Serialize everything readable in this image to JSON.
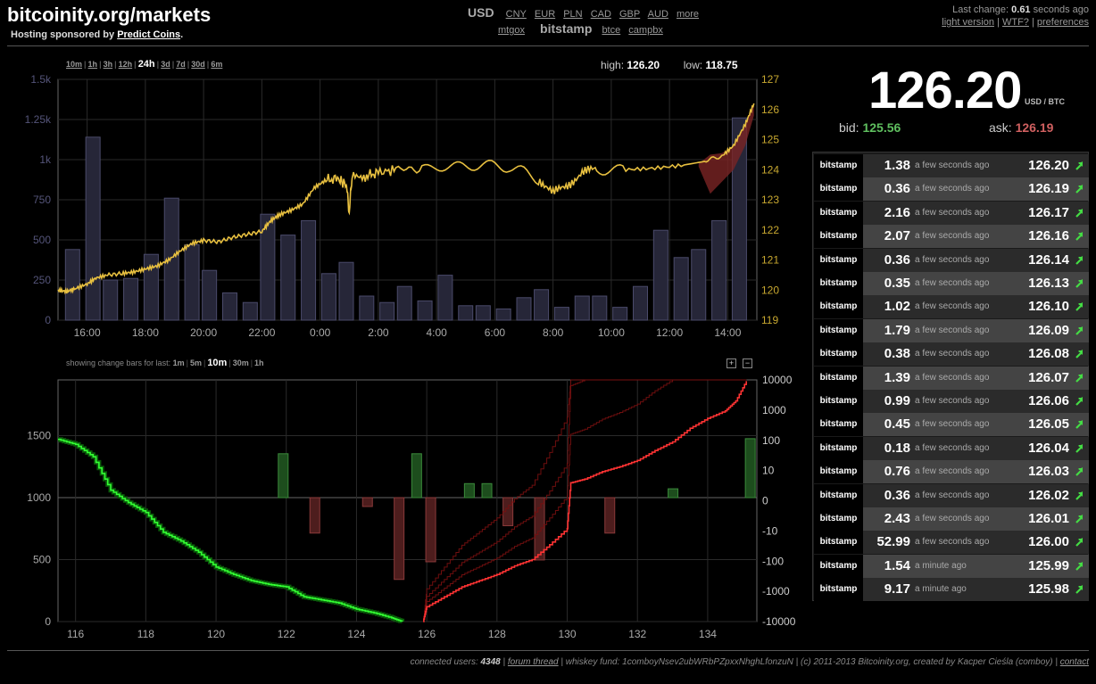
{
  "header": {
    "site_title": "bitcoinity.org/markets",
    "sponsor_prefix": "Hosting sponsored by ",
    "sponsor_link": "Predict Coins",
    "sponsor_suffix": ".",
    "active_currency": "USD",
    "currencies": [
      "CNY",
      "EUR",
      "PLN",
      "CAD",
      "GBP",
      "AUD",
      "more"
    ],
    "exchanges_before": [
      "mtgox"
    ],
    "active_exchange": "bitstamp",
    "exchanges_after": [
      "btce",
      "campbx"
    ],
    "last_change_prefix": "Last change: ",
    "last_change_value": "0.61",
    "last_change_suffix": " seconds ago",
    "links": [
      "light version",
      "WTF?",
      "preferences"
    ]
  },
  "periods": [
    "10m",
    "1h",
    "3h",
    "12h",
    "24h",
    "3d",
    "7d",
    "30d",
    "6m"
  ],
  "selected_period": "24h",
  "high_label": "high:",
  "high_value": "126.20",
  "low_label": "low:",
  "low_value": "118.75",
  "change_bars": {
    "label": "showing change bars for last:",
    "options": [
      "1m",
      "5m",
      "10m",
      "30m",
      "1h"
    ],
    "selected": "10m"
  },
  "ticker": {
    "price": "126.20",
    "unit": "USD / BTC",
    "bid_label": "bid:",
    "bid": "125.56",
    "ask_label": "ask:",
    "ask": "126.19"
  },
  "trades": [
    {
      "exchange": "bitstamp",
      "amount": "1.38",
      "time": "a few seconds ago",
      "price": "126.20"
    },
    {
      "exchange": "bitstamp",
      "amount": "0.36",
      "time": "a few seconds ago",
      "price": "126.19"
    },
    {
      "exchange": "bitstamp",
      "amount": "2.16",
      "time": "a few seconds ago",
      "price": "126.17"
    },
    {
      "exchange": "bitstamp",
      "amount": "2.07",
      "time": "a few seconds ago",
      "price": "126.16"
    },
    {
      "exchange": "bitstamp",
      "amount": "0.36",
      "time": "a few seconds ago",
      "price": "126.14"
    },
    {
      "exchange": "bitstamp",
      "amount": "0.35",
      "time": "a few seconds ago",
      "price": "126.13"
    },
    {
      "exchange": "bitstamp",
      "amount": "1.02",
      "time": "a few seconds ago",
      "price": "126.10"
    },
    {
      "exchange": "bitstamp",
      "amount": "1.79",
      "time": "a few seconds ago",
      "price": "126.09"
    },
    {
      "exchange": "bitstamp",
      "amount": "0.38",
      "time": "a few seconds ago",
      "price": "126.08"
    },
    {
      "exchange": "bitstamp",
      "amount": "1.39",
      "time": "a few seconds ago",
      "price": "126.07"
    },
    {
      "exchange": "bitstamp",
      "amount": "0.99",
      "time": "a few seconds ago",
      "price": "126.06"
    },
    {
      "exchange": "bitstamp",
      "amount": "0.45",
      "time": "a few seconds ago",
      "price": "126.05"
    },
    {
      "exchange": "bitstamp",
      "amount": "0.18",
      "time": "a few seconds ago",
      "price": "126.04"
    },
    {
      "exchange": "bitstamp",
      "amount": "0.76",
      "time": "a few seconds ago",
      "price": "126.03"
    },
    {
      "exchange": "bitstamp",
      "amount": "0.36",
      "time": "a few seconds ago",
      "price": "126.02"
    },
    {
      "exchange": "bitstamp",
      "amount": "2.43",
      "time": "a few seconds ago",
      "price": "126.01"
    },
    {
      "exchange": "bitstamp",
      "amount": "52.99",
      "time": "a few seconds ago",
      "price": "126.00"
    },
    {
      "exchange": "bitstamp",
      "amount": "1.54",
      "time": "a minute ago",
      "price": "125.99"
    },
    {
      "exchange": "bitstamp",
      "amount": "9.17",
      "time": "a minute ago",
      "price": "125.98"
    }
  ],
  "footer": {
    "users_label": "connected users: ",
    "users": "4348",
    "forum": "forum thread",
    "fund": "whiskey fund: 1comboyNsev2ubWRbPZpxxNhghLfonzuN",
    "copyright": "(c) 2011-2013 Bitcoinity.org, created by Kacper Cieśla (comboy)",
    "contact": "contact"
  },
  "colors": {
    "price_line": "#e8c040",
    "volume_bar": "#262638",
    "volume_bar_border": "#4a4a6a",
    "bids": "#33ff33",
    "asks": "#ff3333",
    "up_bar": "#1d4d1d",
    "down_bar": "#4d1d1d",
    "arrow": "#44dd44"
  },
  "chart_data": [
    {
      "type": "line",
      "x_ticks": [
        "16:00",
        "18:00",
        "20:00",
        "22:00",
        "0:00",
        "2:00",
        "4:00",
        "6:00",
        "8:00",
        "10:00",
        "12:00",
        "14:00"
      ],
      "y_left_ticks": [
        "0",
        "250",
        "500",
        "750",
        "1k",
        "1.25k",
        "1.5k"
      ],
      "y_right_ticks": [
        "119",
        "120",
        "121",
        "122",
        "123",
        "124",
        "125",
        "126",
        "127"
      ],
      "ylim_left": [
        0,
        1500
      ],
      "ylim_right": [
        119,
        127
      ],
      "grid": true,
      "volume_x": [
        15.5,
        16.2,
        16.8,
        17.5,
        18.2,
        18.9,
        19.6,
        20.2,
        20.9,
        21.6,
        22.2,
        22.9,
        23.6,
        24.3,
        24.9,
        25.6,
        26.3,
        26.9,
        27.6,
        28.3,
        29.0,
        29.6,
        30.3,
        31.0,
        31.6,
        32.3,
        33.0,
        33.6,
        34.3,
        35.0,
        35.7,
        36.4,
        37.0,
        37.7,
        38.4
      ],
      "volume_values": [
        440,
        1140,
        250,
        260,
        410,
        760,
        470,
        310,
        170,
        110,
        660,
        530,
        620,
        290,
        360,
        150,
        110,
        210,
        120,
        280,
        90,
        90,
        70,
        140,
        190,
        80,
        150,
        150,
        80,
        210,
        560,
        390,
        440,
        620,
        1260
      ],
      "price": [
        {
          "x": 15.0,
          "y": 120.0
        },
        {
          "x": 15.3,
          "y": 119.95
        },
        {
          "x": 15.6,
          "y": 120.05
        },
        {
          "x": 16.0,
          "y": 120.2
        },
        {
          "x": 16.3,
          "y": 120.4
        },
        {
          "x": 16.7,
          "y": 120.5
        },
        {
          "x": 17.2,
          "y": 120.55
        },
        {
          "x": 17.6,
          "y": 120.6
        },
        {
          "x": 18.0,
          "y": 120.7
        },
        {
          "x": 18.4,
          "y": 120.8
        },
        {
          "x": 18.8,
          "y": 121.0
        },
        {
          "x": 19.2,
          "y": 121.3
        },
        {
          "x": 19.6,
          "y": 121.55
        },
        {
          "x": 20.0,
          "y": 121.65
        },
        {
          "x": 20.5,
          "y": 121.6
        },
        {
          "x": 21.0,
          "y": 121.75
        },
        {
          "x": 21.5,
          "y": 121.85
        },
        {
          "x": 22.0,
          "y": 121.95
        },
        {
          "x": 22.3,
          "y": 122.3
        },
        {
          "x": 22.6,
          "y": 122.5
        },
        {
          "x": 23.0,
          "y": 122.65
        },
        {
          "x": 23.4,
          "y": 122.85
        },
        {
          "x": 23.8,
          "y": 123.4
        },
        {
          "x": 24.2,
          "y": 123.65
        },
        {
          "x": 24.6,
          "y": 123.7
        },
        {
          "x": 24.9,
          "y": 123.5
        },
        {
          "x": 25.0,
          "y": 122.6
        },
        {
          "x": 25.1,
          "y": 123.75
        },
        {
          "x": 25.6,
          "y": 123.8
        },
        {
          "x": 26.0,
          "y": 123.9
        },
        {
          "x": 26.6,
          "y": 124.0
        },
        {
          "x": 27.5,
          "y": 124.05
        },
        {
          "x": 28.5,
          "y": 124.1
        },
        {
          "x": 29.5,
          "y": 124.15
        },
        {
          "x": 30.5,
          "y": 124.1
        },
        {
          "x": 31.5,
          "y": 123.7
        },
        {
          "x": 32.0,
          "y": 123.2
        },
        {
          "x": 32.5,
          "y": 123.5
        },
        {
          "x": 33.0,
          "y": 123.9
        },
        {
          "x": 33.5,
          "y": 124.0
        },
        {
          "x": 34.5,
          "y": 124.0
        },
        {
          "x": 35.5,
          "y": 124.05
        },
        {
          "x": 36.5,
          "y": 124.15
        },
        {
          "x": 37.2,
          "y": 124.3
        },
        {
          "x": 37.8,
          "y": 124.45
        },
        {
          "x": 38.2,
          "y": 124.8
        },
        {
          "x": 38.6,
          "y": 125.5
        },
        {
          "x": 38.9,
          "y": 126.2
        }
      ]
    },
    {
      "type": "area",
      "x_ticks": [
        "116",
        "118",
        "120",
        "122",
        "124",
        "126",
        "128",
        "130",
        "132",
        "134"
      ],
      "x_values": [
        116,
        118,
        120,
        122,
        124,
        126,
        128,
        130,
        132,
        134
      ],
      "xlim": [
        115.5,
        135.4
      ],
      "y_left_ticks": [
        "0",
        "500",
        "1000",
        "1500"
      ],
      "ylim_left": [
        0,
        1950
      ],
      "y_right_ticks": [
        "-10000",
        "-1000",
        "-100",
        "-10",
        "0",
        "10",
        "100",
        "1000",
        "10000"
      ],
      "grid": true,
      "bids_depth": [
        {
          "x": 115.5,
          "y": 1470
        },
        {
          "x": 116.0,
          "y": 1430
        },
        {
          "x": 116.5,
          "y": 1330
        },
        {
          "x": 117.0,
          "y": 1060
        },
        {
          "x": 117.5,
          "y": 960
        },
        {
          "x": 118.0,
          "y": 880
        },
        {
          "x": 118.5,
          "y": 720
        },
        {
          "x": 119.0,
          "y": 650
        },
        {
          "x": 119.5,
          "y": 560
        },
        {
          "x": 120.0,
          "y": 440
        },
        {
          "x": 120.5,
          "y": 380
        },
        {
          "x": 121.0,
          "y": 330
        },
        {
          "x": 121.5,
          "y": 300
        },
        {
          "x": 122.0,
          "y": 280
        },
        {
          "x": 122.5,
          "y": 200
        },
        {
          "x": 123.0,
          "y": 175
        },
        {
          "x": 123.5,
          "y": 150
        },
        {
          "x": 124.0,
          "y": 100
        },
        {
          "x": 124.5,
          "y": 70
        },
        {
          "x": 125.0,
          "y": 30
        },
        {
          "x": 125.3,
          "y": 0
        }
      ],
      "asks_depth": [
        {
          "x": 125.9,
          "y": 0
        },
        {
          "x": 126.0,
          "y": 120
        },
        {
          "x": 126.5,
          "y": 200
        },
        {
          "x": 127.0,
          "y": 280
        },
        {
          "x": 127.5,
          "y": 330
        },
        {
          "x": 128.0,
          "y": 380
        },
        {
          "x": 128.5,
          "y": 450
        },
        {
          "x": 129.0,
          "y": 500
        },
        {
          "x": 129.5,
          "y": 620
        },
        {
          "x": 130.0,
          "y": 750
        },
        {
          "x": 130.1,
          "y": 1120
        },
        {
          "x": 130.5,
          "y": 1150
        },
        {
          "x": 131.0,
          "y": 1210
        },
        {
          "x": 131.5,
          "y": 1250
        },
        {
          "x": 132.0,
          "y": 1300
        },
        {
          "x": 132.5,
          "y": 1380
        },
        {
          "x": 133.0,
          "y": 1450
        },
        {
          "x": 133.5,
          "y": 1560
        },
        {
          "x": 134.0,
          "y": 1640
        },
        {
          "x": 134.5,
          "y": 1700
        },
        {
          "x": 134.8,
          "y": 1780
        },
        {
          "x": 135.1,
          "y": 1940
        }
      ],
      "change_bars": [
        {
          "x": 121.9,
          "v": 30
        },
        {
          "x": 122.8,
          "v": -15
        },
        {
          "x": 124.3,
          "v": -1
        },
        {
          "x": 125.2,
          "v": -600
        },
        {
          "x": 125.7,
          "v": 30
        },
        {
          "x": 126.1,
          "v": -150
        },
        {
          "x": 127.2,
          "v": 2
        },
        {
          "x": 127.7,
          "v": 2
        },
        {
          "x": 128.3,
          "v": -8
        },
        {
          "x": 129.2,
          "v": -130
        },
        {
          "x": 131.2,
          "v": -15
        },
        {
          "x": 133.0,
          "v": 1
        },
        {
          "x": 135.2,
          "v": 100
        }
      ]
    }
  ]
}
